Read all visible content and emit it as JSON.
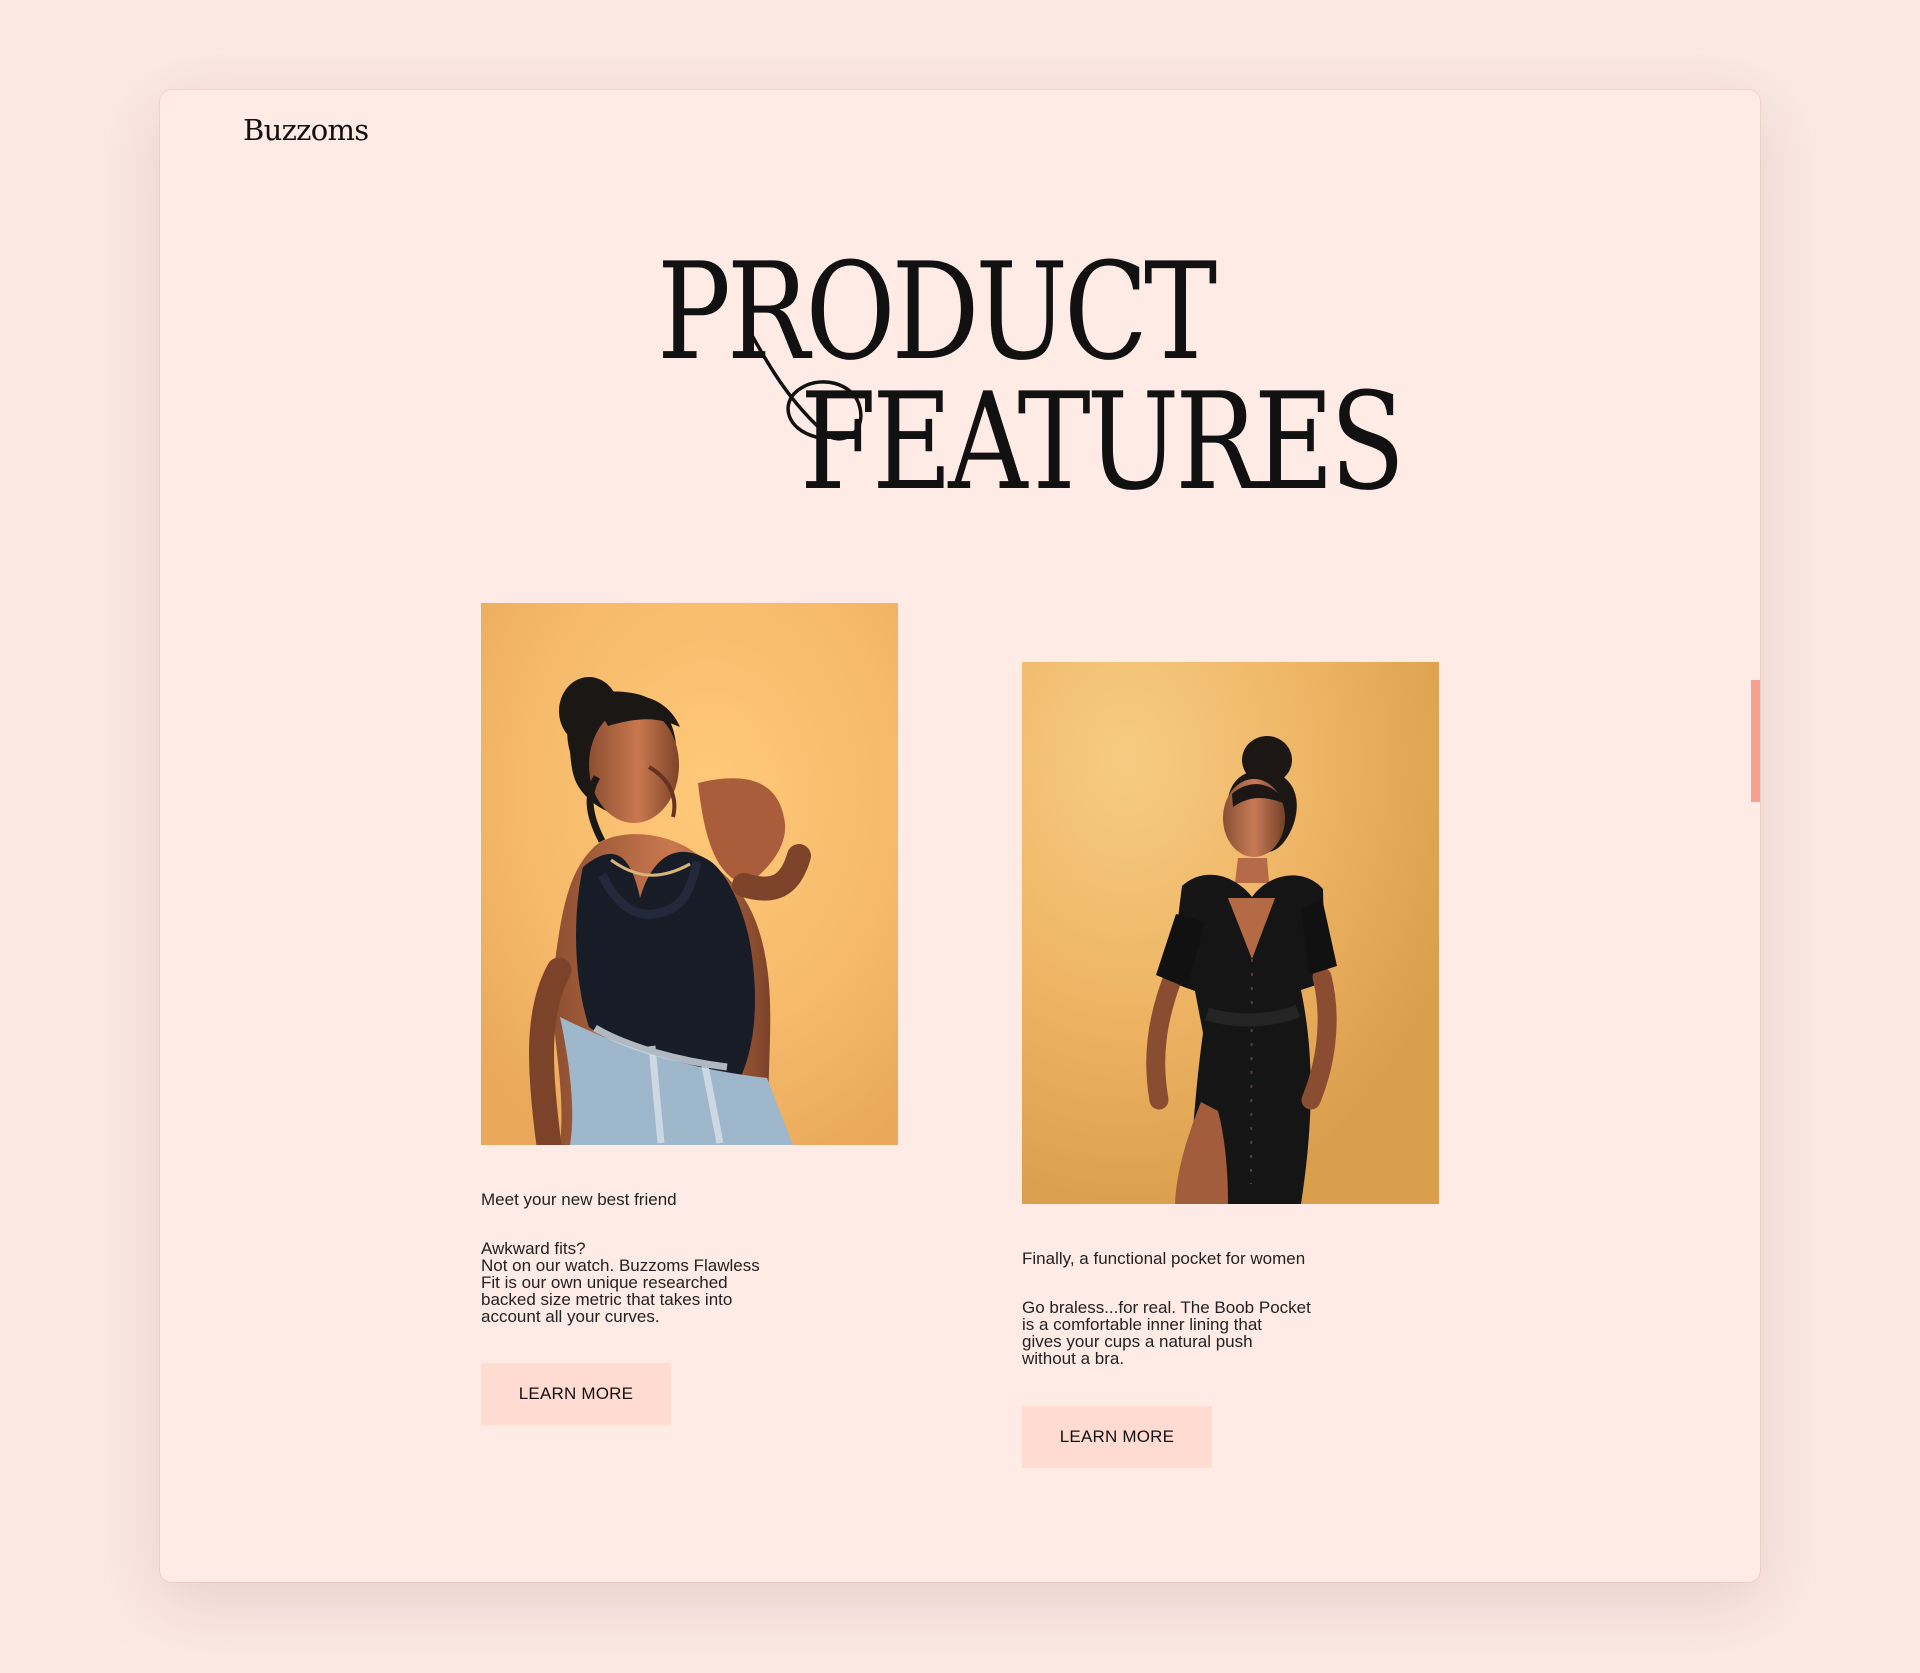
{
  "brand": {
    "name": "Buzzoms"
  },
  "hero": {
    "line_one": "PRODUCT",
    "line_two": "FEATURES"
  },
  "features": [
    {
      "heading": "Meet your new best friend",
      "body": "Awkward fits?\nNot on our watch. Buzzoms Flawless\nFit is our own unique researched\nbacked size metric that takes into\naccount all your curves.",
      "button_label": "LEARN MORE"
    },
    {
      "heading": "Finally, a functional pocket for women",
      "body": "Go braless...for real. The Boob Pocket\nis a comfortable inner lining that\ngives your cups a natural push\nwithout a bra.",
      "button_label": "LEARN MORE"
    }
  ],
  "colors": {
    "page_background": "#fbe9e4",
    "panel_background": "#ffebe5",
    "button_background": "#ffdbd1",
    "scroll_indicator": "#f7a08f",
    "photo_background": "#f2b867"
  }
}
